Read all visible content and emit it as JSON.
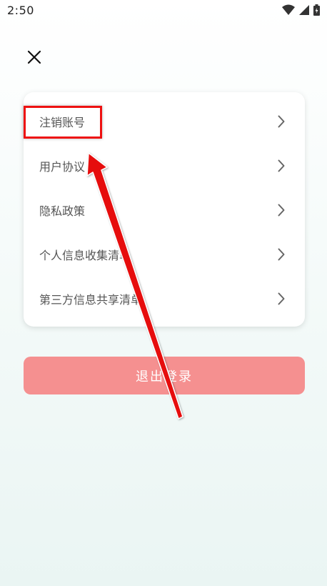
{
  "status_bar": {
    "time": "2:50",
    "icons": [
      "wifi-icon",
      "signal-icon",
      "battery-icon"
    ]
  },
  "header": {
    "close_icon": "close-icon"
  },
  "menu": {
    "items": [
      {
        "label": "注销账号",
        "icon": "chevron-right-icon"
      },
      {
        "label": "用户协议",
        "icon": "chevron-right-icon"
      },
      {
        "label": "隐私政策",
        "icon": "chevron-right-icon"
      },
      {
        "label": "个人信息收集清单",
        "icon": "chevron-right-icon"
      },
      {
        "label": "第三方信息共享清单",
        "icon": "chevron-right-icon"
      }
    ]
  },
  "logout": {
    "label": "退出登录"
  },
  "colors": {
    "logout_bg": "#f59090",
    "annotation": "#e11111",
    "card_bg": "#ffffff"
  }
}
